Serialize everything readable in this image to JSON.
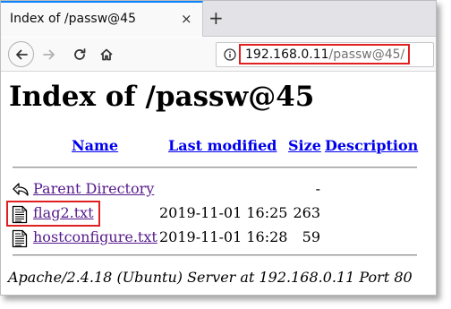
{
  "browser": {
    "tab_title": "Index of /passw@45",
    "tab_close": "×",
    "new_tab": "+",
    "url_host": "192.168.0.11",
    "url_path": "/passw@45/"
  },
  "page": {
    "title": "Index of /passw@45",
    "columns": {
      "name": "Name",
      "last_modified": "Last modified",
      "size": "Size",
      "description": "Description"
    },
    "rows": [
      {
        "icon": "back-arrow-icon",
        "name": "Parent Directory",
        "modified": "",
        "size": "-"
      },
      {
        "icon": "text-file-icon",
        "name": "flag2.txt",
        "modified": "2019-11-01 16:25",
        "size": "263"
      },
      {
        "icon": "text-file-icon",
        "name": "hostconfigure.txt",
        "modified": "2019-11-01 16:28",
        "size": "59"
      }
    ],
    "server_signature": "Apache/2.4.18 (Ubuntu) Server at 192.168.0.11 Port 80"
  },
  "colors": {
    "highlight": "#e02020",
    "link": "#0000ee",
    "visited_link": "#551a8b",
    "tab_accent": "#0a84ff"
  }
}
